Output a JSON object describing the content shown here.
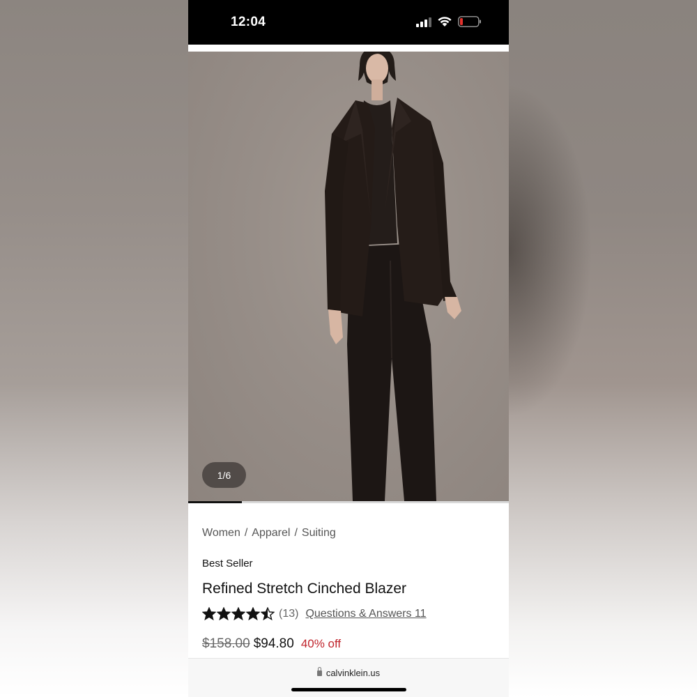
{
  "status_bar": {
    "time": "12:04"
  },
  "gallery": {
    "counter": "1/6",
    "current_image": 1,
    "total_images": 6
  },
  "product": {
    "breadcrumb": [
      "Women",
      "Apparel",
      "Suiting"
    ],
    "badge": "Best Seller",
    "title": "Refined Stretch Cinched Blazer",
    "rating": 4.5,
    "review_count": "(13)",
    "qa_link": "Questions & Answers 11",
    "original_price": "$158.00",
    "sale_price": "$94.80",
    "discount": "40% off"
  },
  "browser": {
    "url": "calvinklein.us"
  },
  "icons": [
    "signal-icon",
    "wifi-icon",
    "battery-icon",
    "star-icon",
    "lock-icon"
  ],
  "colors": {
    "discount": "#c0242c",
    "battery_low": "#e5322d"
  }
}
